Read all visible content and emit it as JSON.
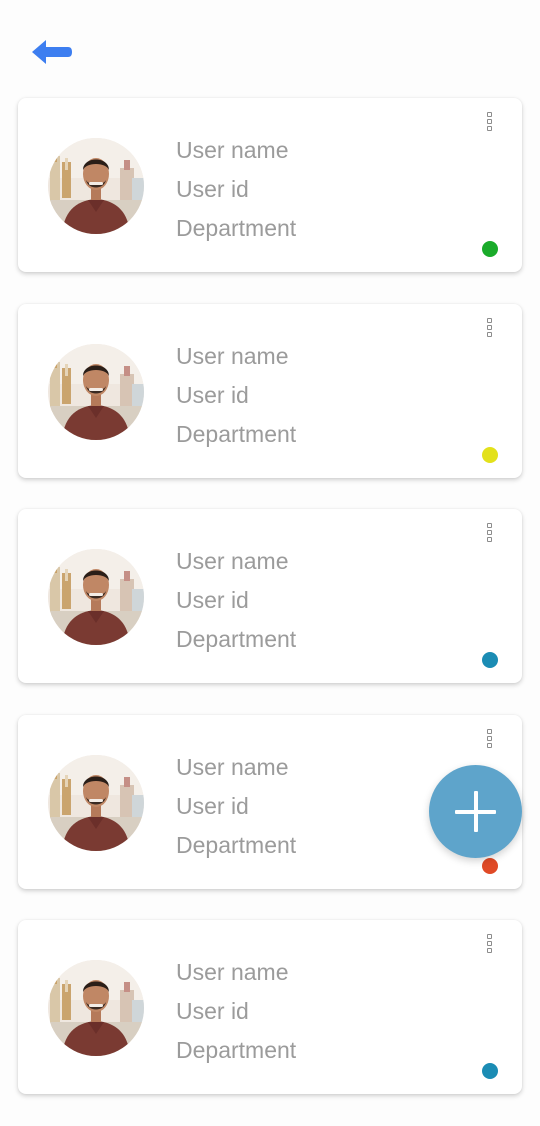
{
  "header": {
    "back_icon": "arrow-left-icon",
    "back_color": "#3d7ef0"
  },
  "users": [
    {
      "name_label": "User name",
      "id_label": "User id",
      "department_label": "Department",
      "status_color": "#1aab2a",
      "avatar_icon": "user-avatar"
    },
    {
      "name_label": "User name",
      "id_label": "User id",
      "department_label": "Department",
      "status_color": "#e3e11b",
      "avatar_icon": "user-avatar"
    },
    {
      "name_label": "User name",
      "id_label": "User id",
      "department_label": "Department",
      "status_color": "#1b8cb4",
      "avatar_icon": "user-avatar"
    },
    {
      "name_label": "User name",
      "id_label": "User id",
      "department_label": "Department",
      "status_color": "#e04a26",
      "avatar_icon": "user-avatar"
    },
    {
      "name_label": "User name",
      "id_label": "User id",
      "department_label": "Department",
      "status_color": "#1b8cb4",
      "avatar_icon": "user-avatar"
    }
  ],
  "fab": {
    "icon": "plus-icon",
    "color": "#5ea4cb"
  }
}
